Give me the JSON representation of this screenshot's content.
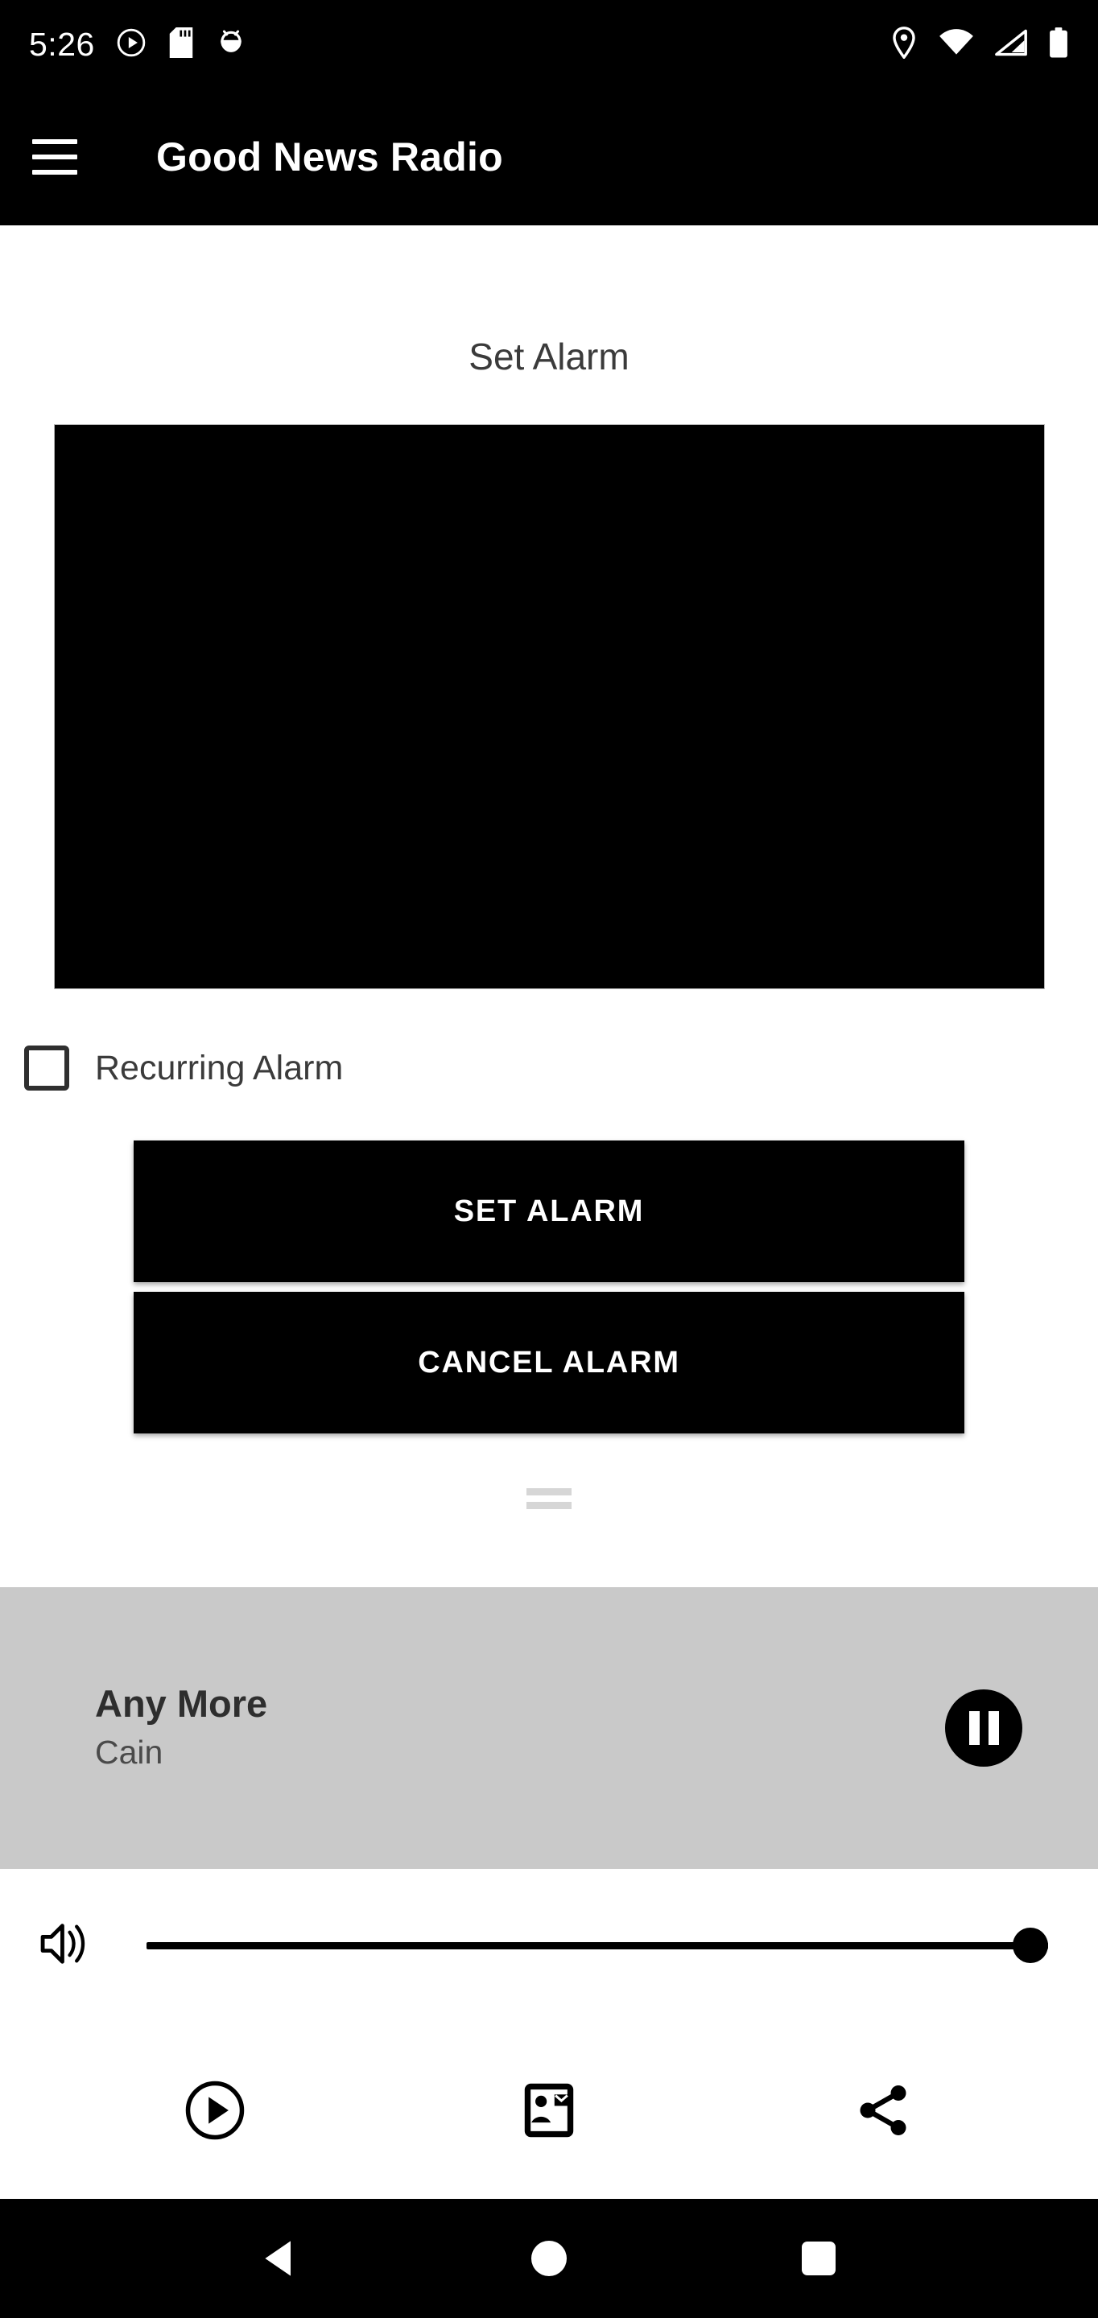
{
  "status_bar": {
    "time": "5:26",
    "left_icons": [
      "play-circle-icon",
      "sd-card-icon",
      "android-debug-icon"
    ],
    "right_icons": [
      "location-icon",
      "wifi-icon",
      "cellular-signal-icon",
      "battery-icon"
    ]
  },
  "app_bar": {
    "menu_icon": "hamburger-menu-icon",
    "title": "Good News Radio"
  },
  "main": {
    "section_title": "Set Alarm",
    "time_picker": {
      "name": "time-picker",
      "background_color": "#000000"
    },
    "recurring": {
      "label": "Recurring Alarm",
      "checked": false
    },
    "buttons": [
      {
        "label": "SET ALARM",
        "name": "set-alarm-button"
      },
      {
        "label": "CANCEL ALARM",
        "name": "cancel-alarm-button"
      }
    ]
  },
  "now_playing": {
    "handle": "drag-handle",
    "title": "Any More",
    "artist": "Cain",
    "transport_icon": "pause-icon",
    "background_color": "#c9c9c9"
  },
  "volume": {
    "icon": "volume-up-icon",
    "value": 100,
    "min": 0,
    "max": 100
  },
  "actions": [
    {
      "name": "play-circle-icon",
      "label": "play-circle-icon"
    },
    {
      "name": "contact-mail-icon",
      "label": "contact-mail-icon"
    },
    {
      "name": "share-icon",
      "label": "share-icon"
    }
  ],
  "nav_bar": {
    "back": "back-triangle-icon",
    "home": "home-circle-icon",
    "recents": "recents-square-icon"
  },
  "colors": {
    "accent": "#000000",
    "surface": "#ffffff",
    "player_bar": "#c9c9c9",
    "muted_text": "#3b3b3b"
  }
}
